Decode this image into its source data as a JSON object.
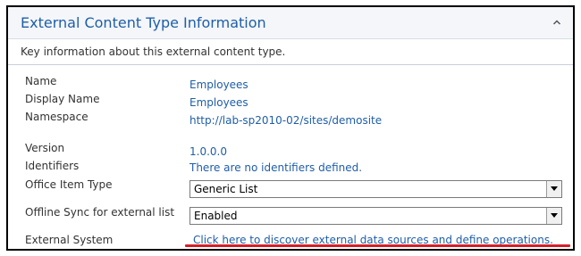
{
  "section": {
    "title": "External Content Type Information",
    "collapse_icon": "chevron-up-icon",
    "description": "Key information about this external content type."
  },
  "fields": {
    "name": {
      "label": "Name",
      "value": "Employees"
    },
    "display_name": {
      "label": "Display Name",
      "value": "Employees"
    },
    "namespace": {
      "label": "Namespace",
      "value": "http://lab-sp2010-02/sites/demosite"
    },
    "version": {
      "label": "Version",
      "value": "1.0.0.0"
    },
    "identifiers": {
      "label": "Identifiers",
      "value": "There are no identifiers defined."
    },
    "office_item_type": {
      "label": "Office Item Type",
      "selected": "Generic List"
    },
    "offline_sync": {
      "label": "Offline Sync for external list",
      "selected": "Enabled"
    },
    "external_system": {
      "label": "External System",
      "link": "Click here to discover external data sources and define operations."
    }
  },
  "colors": {
    "link": "#1f5ea8",
    "annotation": "#d42027"
  }
}
